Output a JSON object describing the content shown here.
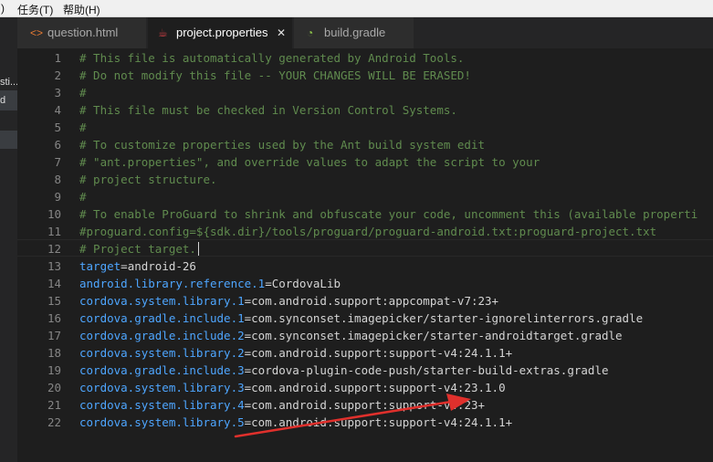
{
  "menubar": {
    "items": [
      ")",
      "任务(T)",
      "帮助(H)"
    ]
  },
  "sidebar": {
    "items": [
      "sti...",
      "d"
    ]
  },
  "tabs": [
    {
      "label": "question.html",
      "icon": "code-icon",
      "icon_glyph": "<>",
      "icon_color": "#e37933",
      "active": false
    },
    {
      "label": "project.properties",
      "icon": "java-file-icon",
      "icon_glyph": "☕",
      "icon_color": "#cc3e44",
      "active": true,
      "close": "✕"
    },
    {
      "label": "build.gradle",
      "icon": "gradle-icon",
      "icon_glyph": "◔",
      "icon_color": "#8dc149",
      "active": false
    }
  ],
  "editor": {
    "lines": [
      {
        "n": "1",
        "comment": "# This file is automatically generated by Android Tools."
      },
      {
        "n": "2",
        "comment": "# Do not modify this file -- YOUR CHANGES WILL BE ERASED!"
      },
      {
        "n": "3",
        "comment": "#"
      },
      {
        "n": "4",
        "comment": "# This file must be checked in Version Control Systems."
      },
      {
        "n": "5",
        "comment": "#"
      },
      {
        "n": "6",
        "comment": "# To customize properties used by the Ant build system edit"
      },
      {
        "n": "7",
        "comment": "# \"ant.properties\", and override values to adapt the script to your"
      },
      {
        "n": "8",
        "comment": "# project structure."
      },
      {
        "n": "9",
        "comment": "#"
      },
      {
        "n": "10",
        "comment": "# To enable ProGuard to shrink and obfuscate your code, uncomment this (available properti"
      },
      {
        "n": "11",
        "comment": "#proguard.config=${sdk.dir}/tools/proguard/proguard-android.txt:proguard-project.txt"
      },
      {
        "n": "12",
        "comment": "# Project target."
      },
      {
        "n": "13",
        "key": "target",
        "value": "android-26"
      },
      {
        "n": "14",
        "key": "android.library.reference.1",
        "value": "CordovaLib"
      },
      {
        "n": "15",
        "key": "cordova.system.library.1",
        "value": "com.android.support:appcompat-v7:23+"
      },
      {
        "n": "16",
        "key": "cordova.gradle.include.1",
        "value": "com.synconset.imagepicker/starter-ignorelinterrors.gradle"
      },
      {
        "n": "17",
        "key": "cordova.gradle.include.2",
        "value": "com.synconset.imagepicker/starter-androidtarget.gradle"
      },
      {
        "n": "18",
        "key": "cordova.system.library.2",
        "value": "com.android.support:support-v4:24.1.1+"
      },
      {
        "n": "19",
        "key": "cordova.gradle.include.3",
        "value": "cordova-plugin-code-push/starter-build-extras.gradle"
      },
      {
        "n": "20",
        "key": "cordova.system.library.3",
        "value": "com.android.support:support-v4:23.1.0"
      },
      {
        "n": "21",
        "key": "cordova.system.library.4",
        "value": "com.android.support:support-v4:23+"
      },
      {
        "n": "22",
        "key": "cordova.system.library.5",
        "value": "com.android.support:support-v4:24.1.1+"
      }
    ]
  },
  "colors": {
    "comment": "#608b4e",
    "key": "#4ea6ff",
    "annotation_arrow": "#e0302c"
  }
}
